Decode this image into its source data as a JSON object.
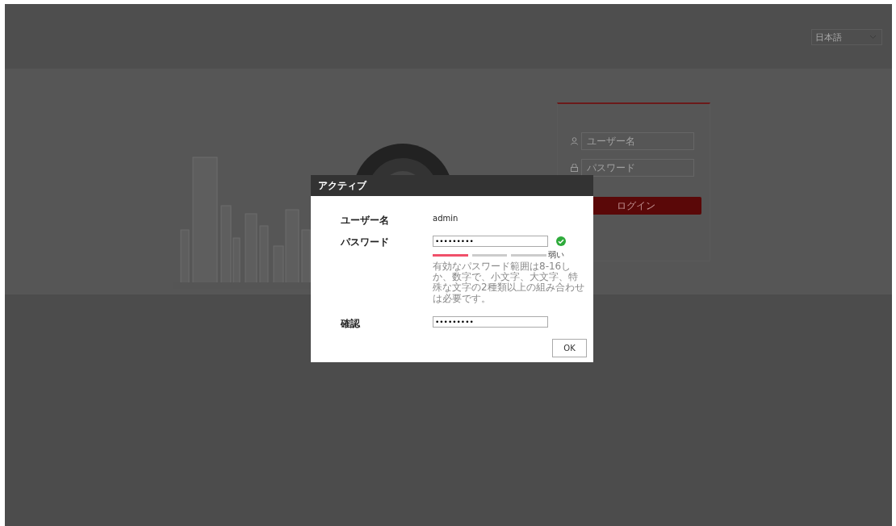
{
  "header": {
    "language": "日本語"
  },
  "login_panel": {
    "username_placeholder": "ユーザー名",
    "password_placeholder": "パスワード",
    "login_button": "ログイン"
  },
  "dialog": {
    "title": "アクティブ",
    "username": {
      "label": "ユーザー名",
      "value": "admin"
    },
    "password": {
      "label": "パスワード",
      "value": "•••••••••",
      "valid": true,
      "strength": {
        "level": 0.33,
        "text": "弱い"
      },
      "hint": "有効なパスワード範囲は8-16しか、数字で、小文字、大文字、特殊な文字の2種類以上の組み合わせは必要です。"
    },
    "confirm": {
      "label": "確認",
      "value": "•••••••••"
    },
    "ok_button": "OK"
  }
}
